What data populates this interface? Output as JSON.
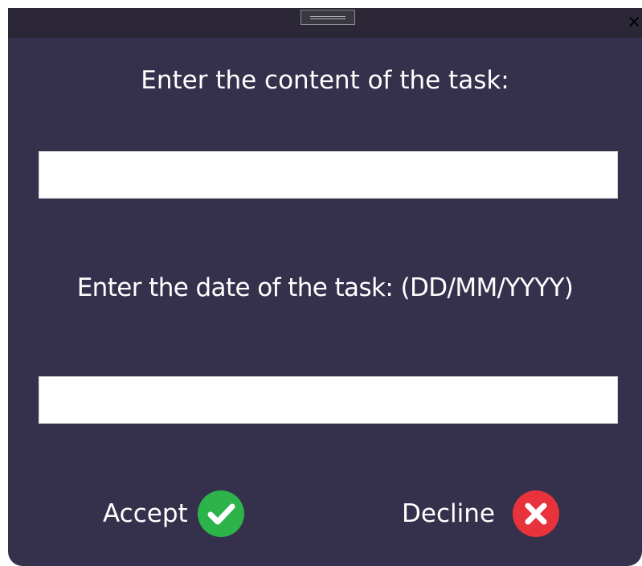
{
  "dialog": {
    "labels": {
      "content": "Enter the content of the task:",
      "date": "Enter the date of the task: (DD/MM/YYYY)"
    },
    "fields": {
      "content_value": "",
      "date_value": ""
    },
    "buttons": {
      "accept_label": "Accept",
      "decline_label": "Decline"
    },
    "close_glyph": "×"
  },
  "colors": {
    "background": "#35304b",
    "titlebar": "#2b2737",
    "accept_icon": "#2cb34a",
    "decline_icon": "#e8323c"
  },
  "icons": {
    "accept": "check-circle-icon",
    "decline": "x-circle-icon",
    "close": "close-icon",
    "drag": "drag-handle-icon"
  }
}
